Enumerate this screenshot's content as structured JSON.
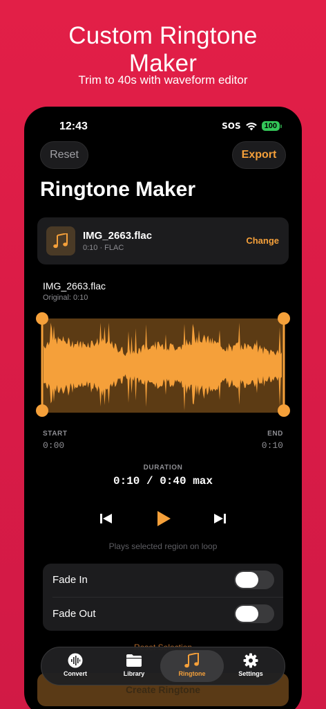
{
  "promo": {
    "title_line1": "Custom Ringtone",
    "title_line2": "Maker",
    "subtitle": "Trim to 40s with waveform editor"
  },
  "status_bar": {
    "time": "12:43",
    "sos": "SOS",
    "battery": "100"
  },
  "header": {
    "reset_label": "Reset",
    "export_label": "Export",
    "title": "Ringtone Maker"
  },
  "file_card": {
    "icon": "music-notes-icon",
    "name": "IMG_2663.flac",
    "meta": "0:10 · FLAC",
    "change_label": "Change"
  },
  "track": {
    "name": "IMG_2663.flac",
    "original": "Original: 0:10"
  },
  "trim": {
    "start_label": "START",
    "start_value": "0:00",
    "end_label": "END",
    "end_value": "0:10",
    "duration_label": "DURATION",
    "duration_value": "0:10 / 0:40 max",
    "selection_start": 0.0,
    "selection_end": 1.0
  },
  "transport": {
    "hint": "Plays selected region on loop"
  },
  "options": {
    "fade_in_label": "Fade In",
    "fade_in_on": false,
    "fade_out_label": "Fade Out",
    "fade_out_on": false
  },
  "actions": {
    "reset_selection_label": "Reset Selection",
    "create_label": "Create Ringtone"
  },
  "tabs": [
    {
      "label": "Convert",
      "icon": "waveform-icon",
      "active": false
    },
    {
      "label": "Library",
      "icon": "folder-icon",
      "active": false
    },
    {
      "label": "Ringtone",
      "icon": "music-notes-icon",
      "active": true
    },
    {
      "label": "Settings",
      "icon": "gear-icon",
      "active": false
    }
  ],
  "colors": {
    "accent": "#f5a03a",
    "background": "#e21f47",
    "card": "#1c1c1e"
  }
}
